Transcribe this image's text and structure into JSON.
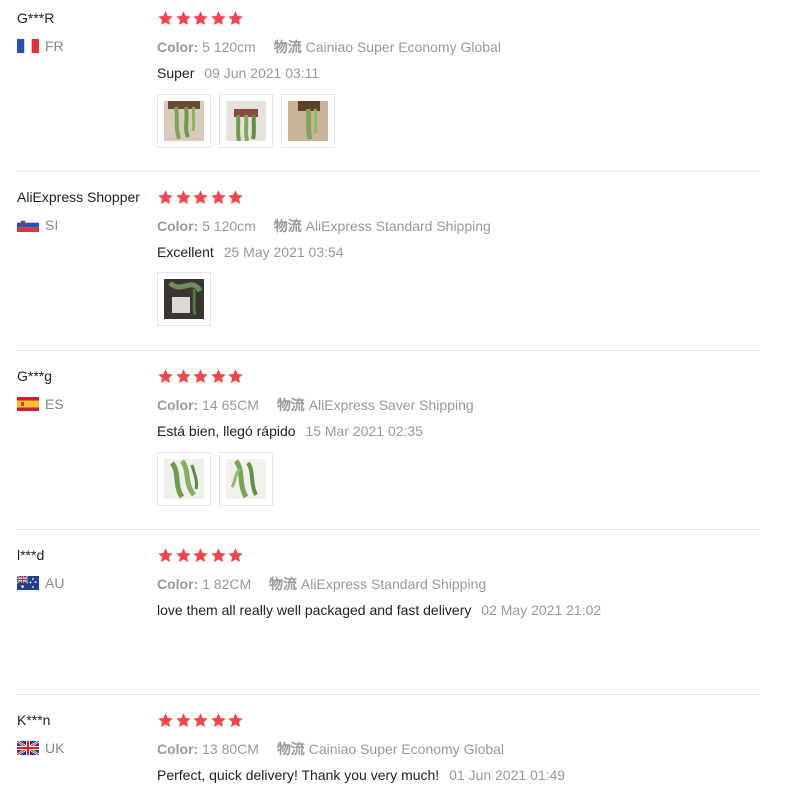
{
  "labels": {
    "color_label": "Color:",
    "shipping_label": "物流"
  },
  "colors": {
    "star": "#f0484f",
    "muted": "#999999",
    "divider": "#e6e6e6"
  },
  "reviews": [
    {
      "user": "G***R",
      "country": "FR",
      "flag_icon": "france-flag-icon",
      "rating": 5,
      "color": "5 120cm",
      "shipping": "Cainiao Super Economy Global",
      "comment": "Super",
      "date": "09 Jun 2021 03:11",
      "photos": [
        "plant-photo",
        "plant-photo",
        "plant-photo"
      ]
    },
    {
      "user": "AliExpress Shopper",
      "country": "SI",
      "flag_icon": "slovenia-flag-icon",
      "rating": 5,
      "color": "5 120cm",
      "shipping": "AliExpress Standard Shipping",
      "comment": "Excellent",
      "date": "25 May 2021 03:54",
      "photos": [
        "plant-photo"
      ]
    },
    {
      "user": "G***g",
      "country": "ES",
      "flag_icon": "spain-flag-icon",
      "rating": 5,
      "color": "14 65CM",
      "shipping": "AliExpress Saver Shipping",
      "comment": "Está bien, llegó rápido",
      "date": "15 Mar 2021 02:35",
      "photos": [
        "plant-photo",
        "plant-photo"
      ]
    },
    {
      "user": "l***d",
      "country": "AU",
      "flag_icon": "australia-flag-icon",
      "rating": 5,
      "color": "1 82CM",
      "shipping": "AliExpress Standard Shipping",
      "comment": "love them all really well packaged and fast delivery",
      "date": "02 May 2021 21:02",
      "photos": []
    },
    {
      "user": "K***n",
      "country": "UK",
      "flag_icon": "uk-flag-icon",
      "rating": 5,
      "color": "13 80CM",
      "shipping": "Cainiao Super Economy Global",
      "comment": "Perfect, quick delivery! Thank you very much!",
      "date": "01 Jun 2021 01:49",
      "photos": []
    }
  ]
}
